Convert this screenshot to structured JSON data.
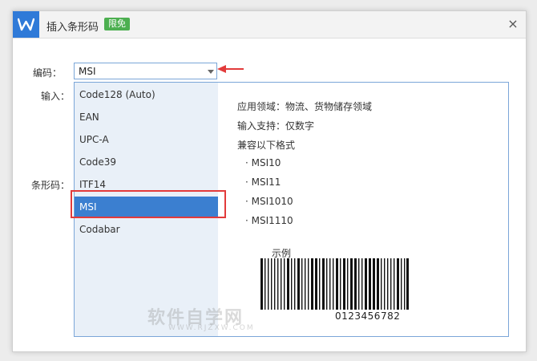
{
  "window": {
    "title": "插入条形码",
    "badge": "限免",
    "close_glyph": "×",
    "app_icon": "wps-logo-icon"
  },
  "form": {
    "encoding_label": "编码：",
    "input_label": "输入：",
    "barcode_label": "条形码：",
    "encoding_value": "MSI"
  },
  "dropdown": {
    "options": [
      "Code128 (Auto)",
      "EAN",
      "UPC-A",
      "Code39",
      "ITF14",
      "MSI",
      "Codabar"
    ],
    "selected": "MSI"
  },
  "info": {
    "applications": "应用领域：物流、货物储存领域",
    "input_support": "输入支持：仅数字",
    "compatible": "兼容以下格式",
    "formats": [
      "· MSI10",
      "· MSI11",
      "· MSI1010",
      "· MSI1110"
    ],
    "example_label": "示例",
    "example_digits": "0123456782"
  },
  "watermark": {
    "text": "软件自学网",
    "sub": "WWW.RJZXW.COM"
  },
  "colors": {
    "accent": "#2f7ad8",
    "selected_bg": "#3b7fd0",
    "highlight_red": "#e23b3b",
    "badge_green": "#4caf50"
  }
}
